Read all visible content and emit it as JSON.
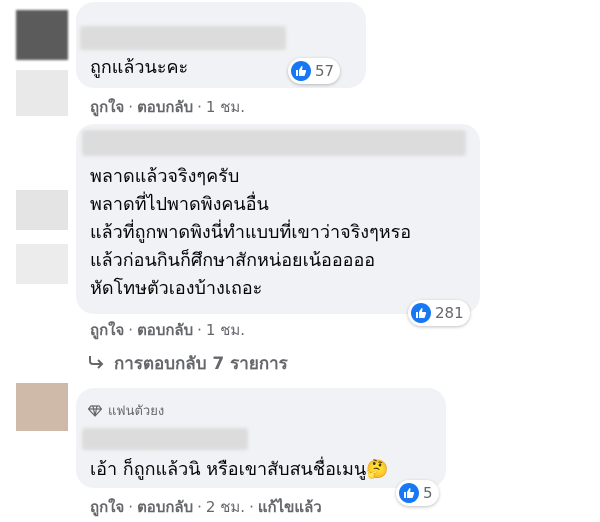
{
  "comments": [
    {
      "text_lines": [
        "ถูกแล้วนะคะ"
      ],
      "reaction_count": "57",
      "like_label": "ถูกใจ",
      "reply_label": "ตอบกลับ",
      "time": "1 ชม."
    },
    {
      "text_lines": [
        "พลาดแล้วจริงๆครับ",
        "พลาดที่ไปพาดพิงคนอื่น",
        "แล้วที่ถูกพาดพิงนี่ทำแบบที่เขาว่าจริงๆหรอ",
        "แล้วก่อนกินก็ศึกษาสักหน่อยเน้อออออ",
        "หัดโทษตัวเองบ้างเถอะ"
      ],
      "reaction_count": "281",
      "like_label": "ถูกใจ",
      "reply_label": "ตอบกลับ",
      "time": "1 ชม.",
      "replies_label": "การตอบกลับ 7 รายการ"
    },
    {
      "badge": "แฟนตัวยง",
      "text_lines": [
        "เอ้า ก็ถูกแล้วนิ หรือเขาสับสนชื่อเมนู🤔"
      ],
      "reaction_count": "5",
      "like_label": "ถูกใจ",
      "reply_label": "ตอบกลับ",
      "time": "2 ชม.",
      "edited_label": "แก้ไขแล้ว"
    }
  ],
  "colors": {
    "like_blue": "#1877f2",
    "bubble": "#f0f2f5",
    "meta_gray": "#65676b"
  },
  "icons": {
    "reaction": "like-thumb-icon",
    "reply_arrow": "reply-arrow-icon",
    "badge": "diamond-icon"
  }
}
